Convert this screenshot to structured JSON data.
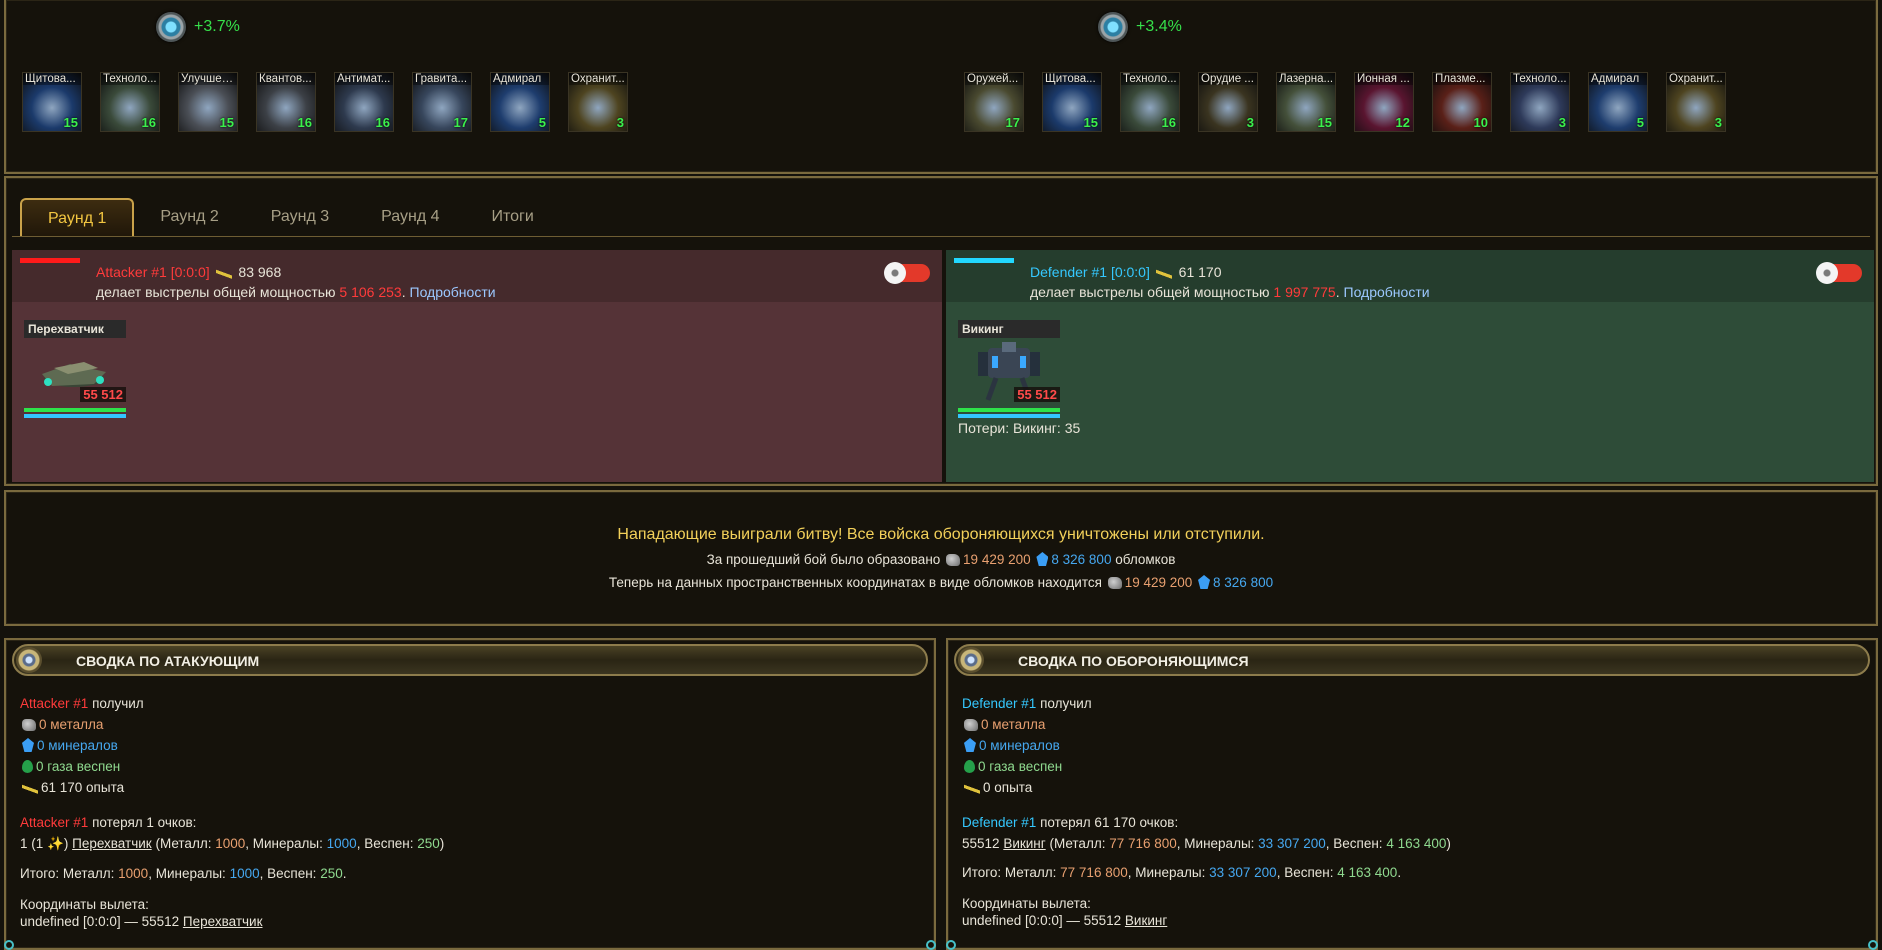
{
  "attacker_techs": {
    "bonus": "+3.7%",
    "items": [
      {
        "name": "Щитова...",
        "level": "15",
        "icon": "shield-tech-icon",
        "color": "#1b3a6b"
      },
      {
        "name": "Техноло...",
        "level": "16",
        "icon": "tech-armor-icon",
        "color": "#3a4a3a"
      },
      {
        "name": "Улучшен...",
        "level": "15",
        "icon": "improved-weapon-icon",
        "color": "#4a4e55"
      },
      {
        "name": "Квантов...",
        "level": "16",
        "icon": "quantum-icon",
        "color": "#3c4046"
      },
      {
        "name": "Антимат...",
        "level": "16",
        "icon": "antimatter-icon",
        "color": "#2e3a4e"
      },
      {
        "name": "Гравита...",
        "level": "17",
        "icon": "gravity-icon",
        "color": "#37465c"
      },
      {
        "name": "Адмирал",
        "level": "5",
        "icon": "admiral-icon",
        "color": "#1e3d6e"
      },
      {
        "name": "Охранит...",
        "level": "3",
        "icon": "guardian-icon",
        "color": "#4e4420"
      }
    ]
  },
  "defender_techs": {
    "bonus": "+3.4%",
    "items": [
      {
        "name": "Оружей...",
        "level": "17",
        "icon": "weapon-tech-icon",
        "color": "#4a4a30"
      },
      {
        "name": "Щитова...",
        "level": "15",
        "icon": "shield-tech-icon",
        "color": "#1b3a6b"
      },
      {
        "name": "Техноло...",
        "level": "16",
        "icon": "tech-armor-icon",
        "color": "#3a4a3a"
      },
      {
        "name": "Орудие ...",
        "level": "3",
        "icon": "cannon-icon",
        "color": "#3a3420"
      },
      {
        "name": "Лазерна...",
        "level": "15",
        "icon": "laser-icon",
        "color": "#44503a"
      },
      {
        "name": "Ионная ...",
        "level": "12",
        "icon": "ion-icon",
        "color": "#5a1530"
      },
      {
        "name": "Плазме...",
        "level": "10",
        "icon": "plasma-icon",
        "color": "#5a2018"
      },
      {
        "name": "Техноло...",
        "level": "3",
        "icon": "tech-icon",
        "color": "#2e3a5a"
      },
      {
        "name": "Адмирал",
        "level": "5",
        "icon": "admiral-icon",
        "color": "#1e3d6e"
      },
      {
        "name": "Охранит...",
        "level": "3",
        "icon": "guardian-icon",
        "color": "#4e4420"
      }
    ]
  },
  "tabs": [
    "Раунд 1",
    "Раунд 2",
    "Раунд 3",
    "Раунд 4",
    "Итоги"
  ],
  "round": {
    "attacker": {
      "name": "Attacker #1 [0:0:0]",
      "xp": "83 968",
      "shots_prefix": "делает выстрелы общей мощностью",
      "shots_value": "5 106 253",
      "details": "Подробности",
      "unit_name": "Перехватчик",
      "unit_count": "55 512",
      "bar_color": "#ff1a1a"
    },
    "defender": {
      "name": "Defender #1 [0:0:0]",
      "xp": "61 170",
      "shots_prefix": "делает выстрелы общей мощностью",
      "shots_value": "1 997 775",
      "details": "Подробности",
      "unit_name": "Викинг",
      "unit_count": "55 512",
      "losses": "Потери: Викинг: 35",
      "bar_color": "#22d8ff"
    }
  },
  "result": {
    "headline": "Нападающие выиграли битву! Все войска обороняющихся уничтожены или отступили.",
    "debris_prefix": "За прошедший бой было образовано",
    "debris_metal": "19 429 200",
    "debris_crystal": "8 326 800",
    "debris_suffix": "обломков",
    "field_prefix": "Теперь на данных пространственных координатах в виде обломков находится",
    "field_metal": "19 429 200",
    "field_crystal": "8 326 800"
  },
  "summary_attacker": {
    "title": "СВОДКА ПО АТАКУЮЩИМ",
    "player": "Attacker #1",
    "received": "получил",
    "metal": "0 металла",
    "minerals": "0 минералов",
    "gas": "0 газа веспен",
    "xp": "61 170 опыта",
    "lost_text": "потерял 1 очков:",
    "unit_line_prefix": "1 (1",
    "unit_line_star": "✨",
    "unit_line_close": ")",
    "unit_name": "Перехватчик",
    "cost_open": "(Металл:",
    "cost_metal": "1000",
    "cost_min_label": ", Минералы:",
    "cost_min": "1000",
    "cost_gas_label": ", Веспен:",
    "cost_gas": "250",
    "cost_close": ")",
    "total_label": "Итого: Металл:",
    "total_metal": "1000",
    "total_min_label": ", Минералы:",
    "total_min": "1000",
    "total_gas_label": ", Веспен:",
    "total_gas": "250",
    "total_end": ".",
    "coords_label": "Координаты вылета:",
    "coords_prefix": "undefined [0:0:0] — 55512",
    "coords_unit": "Перехватчик"
  },
  "summary_defender": {
    "title": "СВОДКА ПО ОБОРОНЯЮЩИМСЯ",
    "player": "Defender #1",
    "received": "получил",
    "metal": "0 металла",
    "minerals": "0 минералов",
    "gas": "0 газа веспен",
    "xp": "0 опыта",
    "lost_text": "потерял 61 170 очков:",
    "unit_line_prefix": "55512",
    "unit_name": "Викинг",
    "cost_open": "(Металл:",
    "cost_metal": "77 716 800",
    "cost_min_label": ", Минералы:",
    "cost_min": "33 307 200",
    "cost_gas_label": ", Веспен:",
    "cost_gas": "4 163 400",
    "cost_close": ")",
    "total_label": "Итого: Металл:",
    "total_metal": "77 716 800",
    "total_min_label": ", Минералы:",
    "total_min": "33 307 200",
    "total_gas_label": ", Веспен:",
    "total_gas": "4 163 400",
    "total_end": ".",
    "coords_label": "Координаты вылета:",
    "coords_prefix": "undefined [0:0:0] — 55512",
    "coords_unit": "Викинг"
  }
}
